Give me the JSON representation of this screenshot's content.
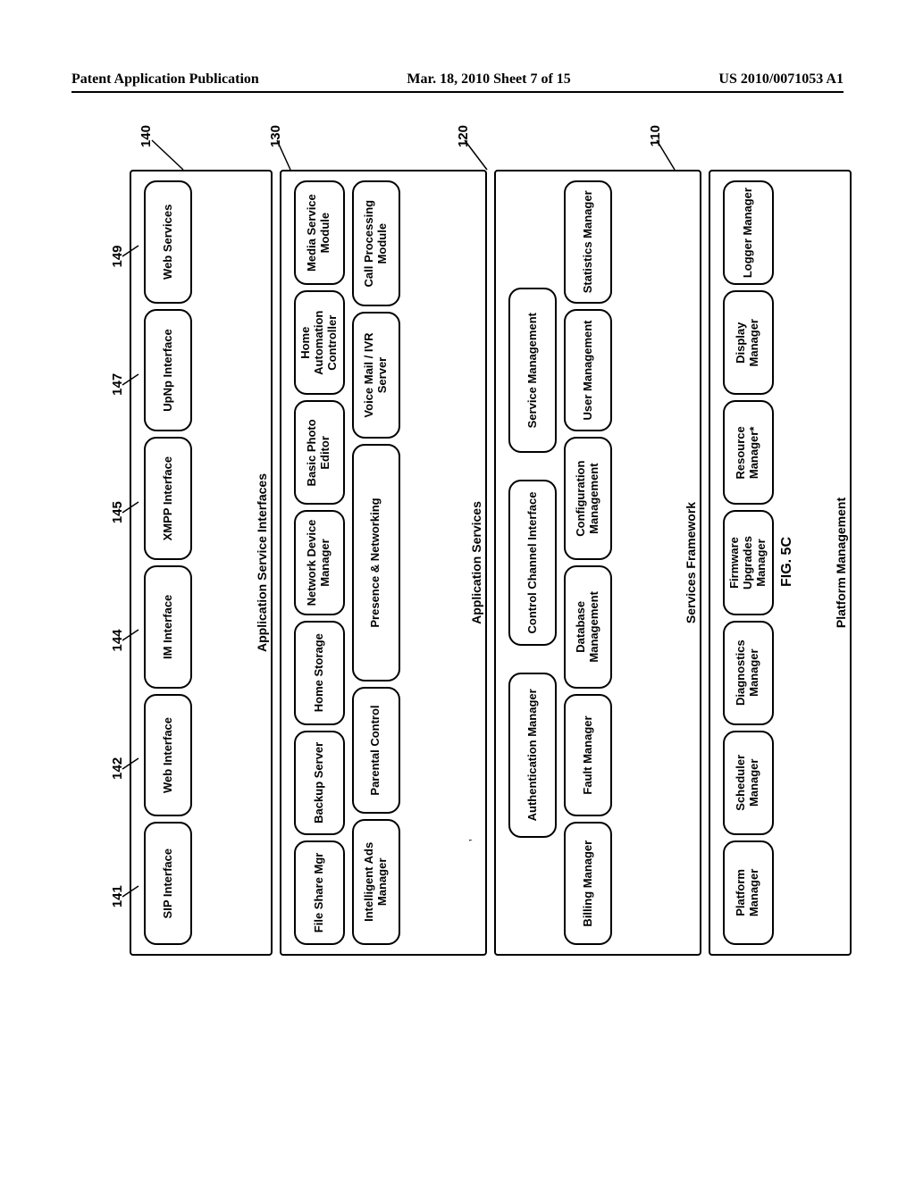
{
  "header": {
    "left": "Patent Application Publication",
    "center": "Mar. 18, 2010  Sheet 7 of 15",
    "right": "US 2010/0071053 A1"
  },
  "figure_caption": "FIG. 5C",
  "layers": [
    {
      "id": "application-service-interfaces",
      "ref": "140",
      "label": "Application Service Interfaces",
      "rows": [
        [
          {
            "text": "SIP Interface",
            "ref": "141"
          },
          {
            "text": "Web Interface",
            "ref": "142"
          },
          {
            "text": "IM Interface",
            "ref": "144"
          },
          {
            "text": "XMPP Interface",
            "ref": "145"
          },
          {
            "text": "UpNp Interface",
            "ref": "147"
          },
          {
            "text": "Web Services",
            "ref": "149"
          }
        ]
      ]
    },
    {
      "id": "application-services",
      "ref": "130",
      "label": "Application Services",
      "rows": [
        [
          {
            "text": "File Share Mgr"
          },
          {
            "text": "Backup Server"
          },
          {
            "text": "Home Storage"
          },
          {
            "text": "Network Device Manager"
          },
          {
            "text": "Basic Photo Editor"
          },
          {
            "text": "Home Automation Controller"
          },
          {
            "text": "Media Service Module"
          }
        ],
        [
          {
            "text": "Intelligent Ads Manager"
          },
          {
            "text": "Parental Control"
          },
          {
            "text": "Presence & Networking",
            "wide": true
          },
          {
            "text": "Voice Mail / IVR Server"
          },
          {
            "text": "Call Processing Module"
          }
        ]
      ]
    },
    {
      "id": "services-framework",
      "ref": "120",
      "label": "Services Framework",
      "rows": [
        [
          {
            "text": "Authentication Manager"
          },
          {
            "text": "Control Channel Interface"
          },
          {
            "text": "Service Management"
          }
        ],
        [
          {
            "text": "Billing Manager"
          },
          {
            "text": "Fault Manager"
          },
          {
            "text": "Database Management"
          },
          {
            "text": "Configuration Management"
          },
          {
            "text": "User Management"
          },
          {
            "text": "Statistics Manager"
          }
        ]
      ]
    },
    {
      "id": "platform-management",
      "ref": "110",
      "label": "Platform Management",
      "rows": [
        [
          {
            "text": "Platform Manager"
          },
          {
            "text": "Scheduler Manager"
          },
          {
            "text": "Diagnostics Manager"
          },
          {
            "text": "Firmware Upgrades Manager"
          },
          {
            "text": "Resource Manager*"
          },
          {
            "text": "Display Manager"
          },
          {
            "text": "Logger Manager"
          }
        ]
      ]
    }
  ],
  "top_refs": [
    "141",
    "142",
    "144",
    "145",
    "147",
    "149"
  ]
}
